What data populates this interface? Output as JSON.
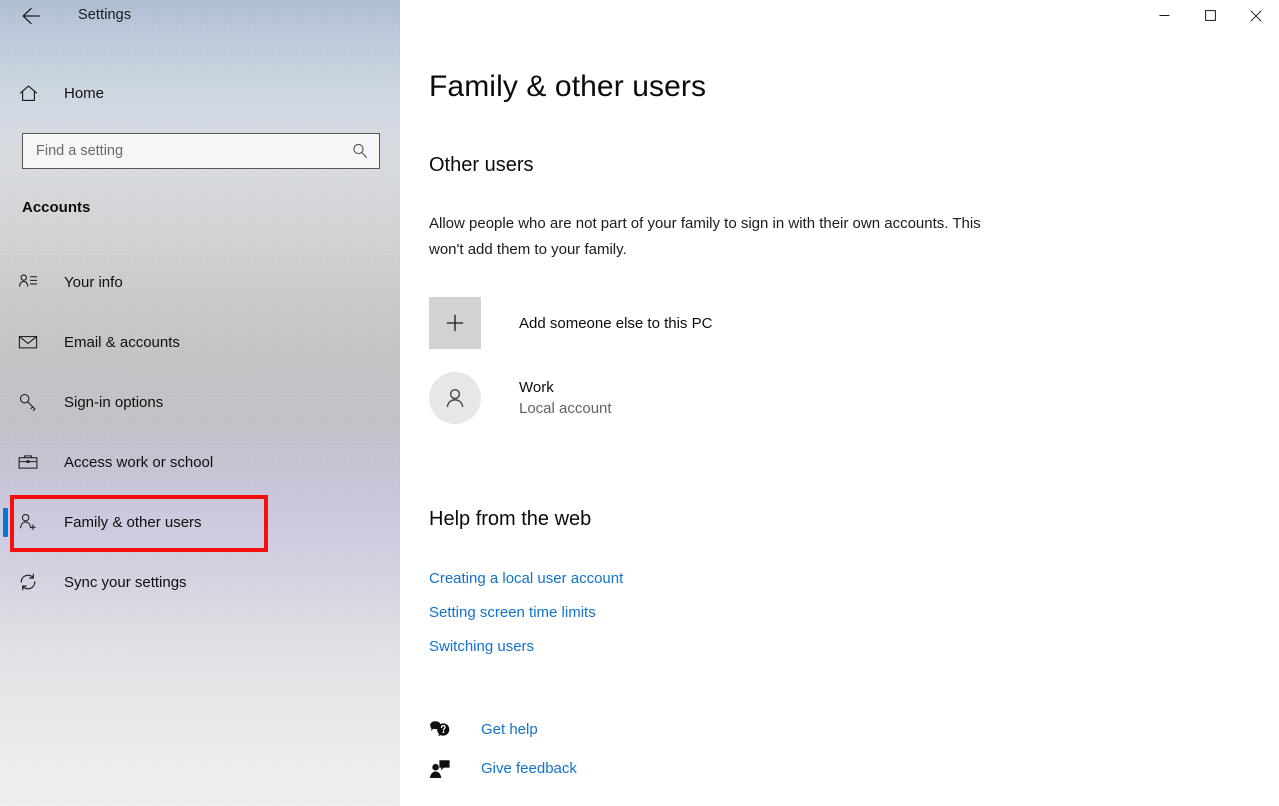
{
  "window": {
    "app_title": "Settings",
    "back_icon": "back-arrow-icon",
    "controls": {
      "minimize": "minimize-icon",
      "maximize": "maximize-icon",
      "close": "close-icon"
    }
  },
  "sidebar": {
    "home_label": "Home",
    "home_icon": "home-icon",
    "search": {
      "placeholder": "Find a setting",
      "value": "",
      "icon": "search-icon"
    },
    "category": "Accounts",
    "items": [
      {
        "label": "Your info",
        "icon": "person-card-icon",
        "selected": false
      },
      {
        "label": "Email & accounts",
        "icon": "envelope-icon",
        "selected": false
      },
      {
        "label": "Sign-in options",
        "icon": "key-icon",
        "selected": false
      },
      {
        "label": "Access work or school",
        "icon": "briefcase-icon",
        "selected": false
      },
      {
        "label": "Family & other users",
        "icon": "person-add-icon",
        "selected": true
      },
      {
        "label": "Sync your settings",
        "icon": "sync-icon",
        "selected": false
      }
    ],
    "highlight": {
      "target": "Family & other users",
      "color": "#f50e0e"
    },
    "accent_color": "#0078d4"
  },
  "main": {
    "page_title": "Family & other users",
    "other_users": {
      "heading": "Other users",
      "description": "Allow people who are not part of your family to sign in with their own accounts. This won't add them to your family.",
      "add_user": {
        "label": "Add someone else to this PC",
        "icon": "plus-icon"
      },
      "accounts": [
        {
          "name": "Work",
          "type": "Local account",
          "icon": "user-avatar-icon"
        }
      ]
    },
    "help": {
      "heading": "Help from the web",
      "links": [
        "Creating a local user account",
        "Setting screen time limits",
        "Switching users"
      ],
      "link_color": "#1272ce"
    },
    "footer": [
      {
        "label": "Get help",
        "icon": "help-bubble-icon"
      },
      {
        "label": "Give feedback",
        "icon": "feedback-person-icon"
      }
    ]
  }
}
